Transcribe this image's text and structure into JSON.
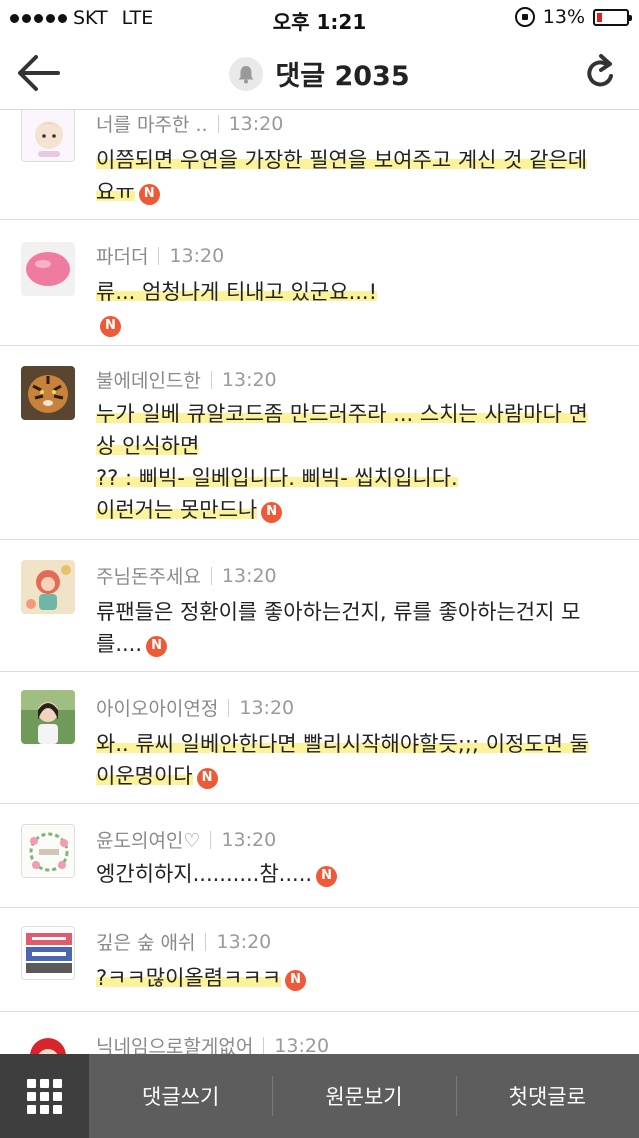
{
  "status_bar": {
    "carrier": "SKT",
    "network": "LTE",
    "time": "오후 1:21",
    "battery": "13%",
    "battery_level": 0.13
  },
  "header": {
    "title": "댓글 2035"
  },
  "comments": [
    {
      "author": "너를 마주한 ..",
      "time": "13:20",
      "lines": [
        "이쯤되면 우연을 가장한 필연을 보여주고 계신 것 같은데",
        "요ㅠ"
      ],
      "badge": "N"
    },
    {
      "author": "파더더",
      "time": "13:20",
      "lines": [
        "류... 엄청나게 티내고 있군요...!"
      ],
      "badge": "N"
    },
    {
      "author": "불에데인드한",
      "time": "13:20",
      "lines": [
        "누가 일베 큐알코드좀 만드러주라 ... 스치는 사람마다 면",
        "상 인식하면",
        "?? : 삐빅- 일베입니다. 삐빅- 씹치입니다.",
        "이런거는 못만드나"
      ],
      "badge": "N"
    },
    {
      "author": "주님돈주세요",
      "time": "13:20",
      "lines": [
        "류팬들은 정환이를 좋아하는건지, 류를 좋아하는건지 모",
        "를...."
      ],
      "badge": "N"
    },
    {
      "author": "아이오아이연정",
      "time": "13:20",
      "lines": [
        "와.. 류씨 일베안한다면 빨리시작해야할듯;;; 이정도면 둘",
        "이운명이다"
      ],
      "badge": "N"
    },
    {
      "author": "윤도의여인♡",
      "time": "13:20",
      "lines": [
        "엥간히하지..........참....."
      ],
      "badge": "N"
    },
    {
      "author": "깊은 숲 애쉬",
      "time": "13:20",
      "lines": [
        "?ㅋㅋ많이올렴ㅋㅋㅋ"
      ],
      "badge": "N"
    },
    {
      "author": "닉네임으로할게없어",
      "time": "13:20",
      "lines": [],
      "badge": ""
    }
  ],
  "bottom_bar": {
    "write": "댓글쓰기",
    "original": "원문보기",
    "first": "첫댓글로"
  },
  "colors": {
    "highlight": "#fbf29a",
    "badge": "#ee5a37",
    "bottom_bar": "#5d5d5d"
  }
}
